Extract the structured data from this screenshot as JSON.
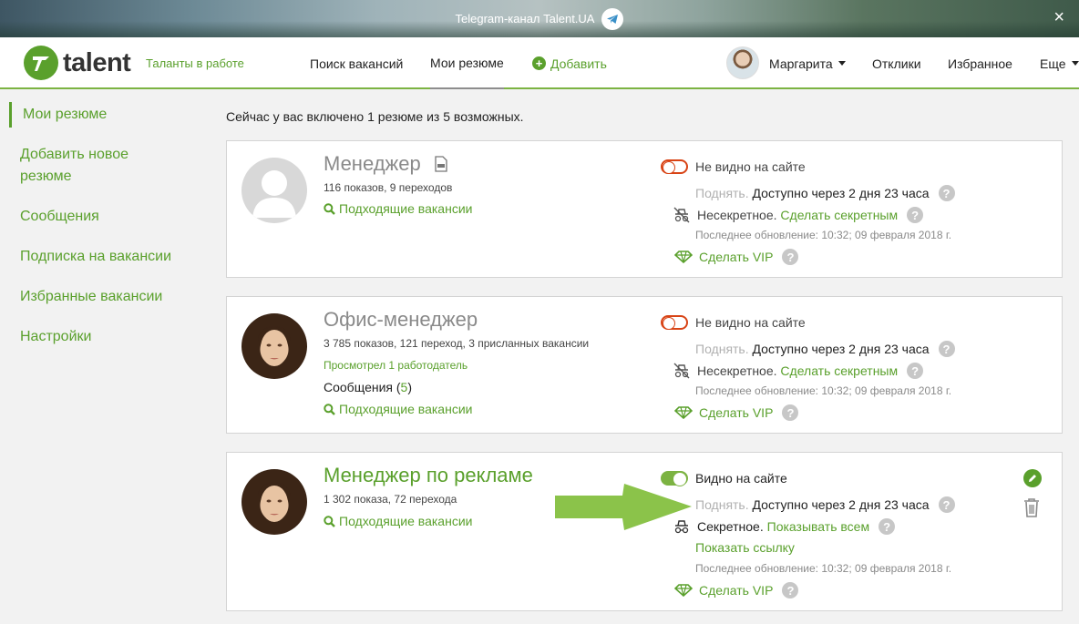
{
  "banner": {
    "text": "Telegram-канал Talent.UA",
    "close": "×"
  },
  "header": {
    "logo_word": "talent",
    "tagline": "Таланты в работе",
    "nav": {
      "search": "Поиск вакансий",
      "my_resumes": "Мои резюме",
      "add": "Добавить",
      "user": "Маргарита",
      "responses": "Отклики",
      "favorites": "Избранное",
      "more": "Еще"
    }
  },
  "sidebar": {
    "items": [
      {
        "label": "Мои резюме"
      },
      {
        "label": "Добавить новое"
      },
      {
        "label": "резюме"
      },
      {
        "label": "Сообщения"
      },
      {
        "label": "Подписка на вакансии"
      },
      {
        "label": "Избранные вакансии"
      },
      {
        "label": "Настройки"
      }
    ]
  },
  "summary": "Сейчас у вас включено 1 резюме из 5 возможных.",
  "resumes": [
    {
      "title": "Менеджер",
      "stats": "116 показов, 9 переходов",
      "matching": "Подходящие вакансии",
      "visibility": "Не видно на сайте",
      "raise": "Поднять.",
      "raise_note": "Доступно через 2 дня 23 часа",
      "secrecy": "Несекретное.",
      "secrecy_action": "Сделать секретным",
      "updated": "Последнее обновление: 10:32; 09 февраля 2018 г.",
      "vip": "Сделать VIP"
    },
    {
      "title": "Офис-менеджер",
      "stats": "3 785 показов, 121 переход, 3 присланных вакансии",
      "viewed": "Просмотрел 1 работодатель",
      "messages_label": "Сообщения (",
      "messages_count": "5",
      "messages_close": ")",
      "matching": "Подходящие вакансии",
      "visibility": "Не видно на сайте",
      "raise": "Поднять.",
      "raise_note": "Доступно через 2 дня 23 часа",
      "secrecy": "Несекретное.",
      "secrecy_action": "Сделать секретным",
      "updated": "Последнее обновление: 10:32; 09 февраля 2018 г.",
      "vip": "Сделать VIP"
    },
    {
      "title": "Менеджер по рекламе",
      "stats": "1 302 показа, 72 перехода",
      "matching": "Подходящие вакансии",
      "visibility": "Видно на сайте",
      "raise": "Поднять.",
      "raise_note": "Доступно через 2 дня 23 часа",
      "secrecy": "Секретное.",
      "secrecy_action": "Показывать всем",
      "show_link": "Показать ссылку",
      "updated": "Последнее обновление: 10:32; 09 февраля 2018 г.",
      "vip": "Сделать VIP"
    }
  ],
  "help_glyph": "?",
  "colors": {
    "brand_green": "#5aa02c",
    "toggle_off": "#d84315",
    "toggle_on": "#7cb342",
    "arrow": "#8bc34a"
  }
}
